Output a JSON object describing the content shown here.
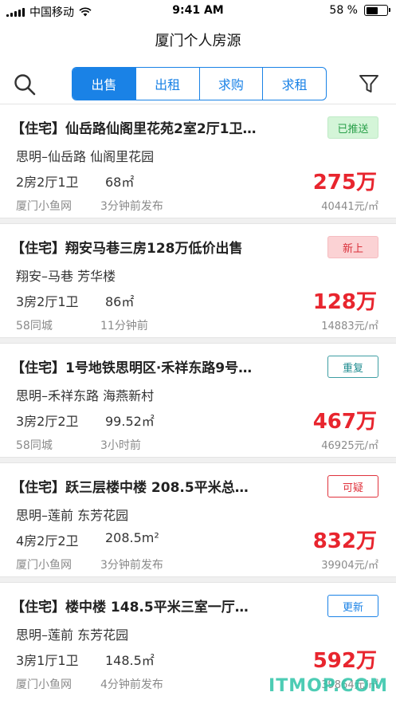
{
  "status_bar": {
    "carrier": "中国移动",
    "time": "9:41 AM",
    "battery_text": "58 %",
    "battery_level": 0.58
  },
  "nav": {
    "title": "厦门个人房源"
  },
  "tabs": [
    {
      "label": "出售",
      "active": true
    },
    {
      "label": "出租",
      "active": false
    },
    {
      "label": "求购",
      "active": false
    },
    {
      "label": "求租",
      "active": false
    }
  ],
  "listings": [
    {
      "title": "【住宅】仙岳路仙阁里花苑2室2厅1卫…",
      "badge": "已推送",
      "location": "思明–仙岳路 仙阁里花园",
      "rooms": "2房2厅1卫",
      "area": "68㎡",
      "price": "275万",
      "source": "厦门小鱼网",
      "time": "3分钟前发布",
      "unit_price": "40441元/㎡"
    },
    {
      "title": "【住宅】翔安马巷三房128万低价出售",
      "badge": "新上",
      "location": "翔安–马巷 芳华楼",
      "rooms": "3房2厅1卫",
      "area": "86㎡",
      "price": "128万",
      "source": "58同城",
      "time": "11分钟前",
      "unit_price": "14883元/㎡"
    },
    {
      "title": "【住宅】1号地铁思明区·禾祥东路9号…",
      "badge": "重复",
      "location": "思明–禾祥东路 海燕新村",
      "rooms": "3房2厅2卫",
      "area": "99.52㎡",
      "price": "467万",
      "source": "58同城",
      "time": "3小时前",
      "unit_price": "46925元/㎡"
    },
    {
      "title": "【住宅】跃三层楼中楼 208.5平米总…",
      "badge": "可疑",
      "location": "思明–莲前 东芳花园",
      "rooms": "4房2厅2卫",
      "area": "208.5m²",
      "price": "832万",
      "source": "厦门小鱼网",
      "time": "3分钟前发布",
      "unit_price": "39904元/㎡"
    },
    {
      "title": "【住宅】楼中楼 148.5平米三室一厅…",
      "badge": "更新",
      "location": "思明–莲前 东芳花园",
      "rooms": "3房1厅1卫",
      "area": "148.5㎡",
      "price": "592万",
      "source": "厦门小鱼网",
      "time": "4分钟前发布",
      "unit_price": "39864元/㎡"
    }
  ],
  "watermark": "ITMOP.COM",
  "icons": {
    "search": "search-icon",
    "filter": "filter-icon",
    "wifi": "wifi-icon",
    "signal": "signal-icon",
    "battery": "battery-icon"
  },
  "colors": {
    "accent": "#1a82e6",
    "price": "#e8252e"
  }
}
